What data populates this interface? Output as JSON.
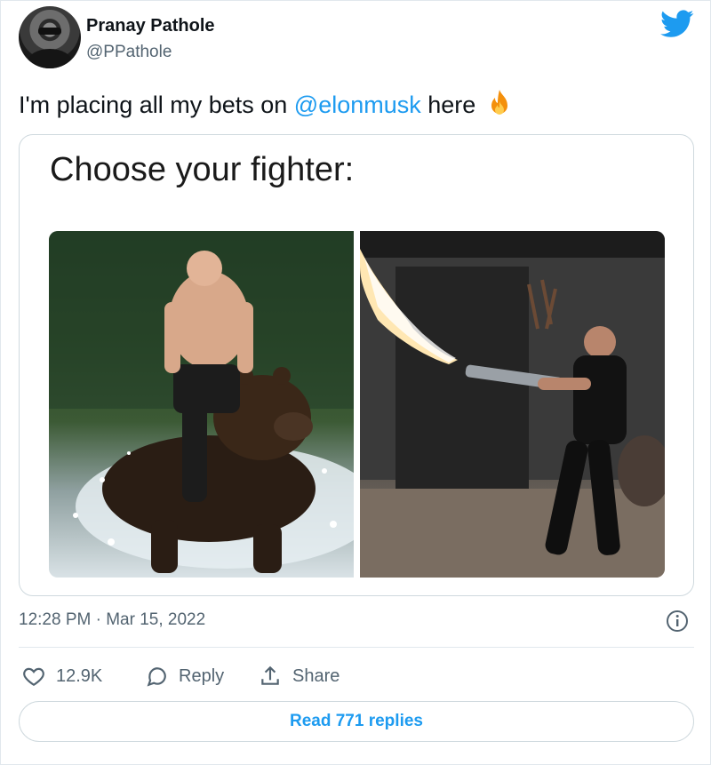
{
  "author": {
    "display_name": "Pranay Pathole",
    "handle": "@PPathole"
  },
  "tweet": {
    "text_before": "I'm placing all my bets on ",
    "mention": "@elonmusk",
    "text_after": " here",
    "emoji": "fire-icon"
  },
  "media": {
    "caption": "Choose your fighter:"
  },
  "meta": {
    "timestamp": "12:28 PM · Mar 15, 2022"
  },
  "actions": {
    "likes": "12.9K",
    "reply_label": "Reply",
    "share_label": "Share"
  },
  "footer": {
    "read_replies_label": "Read 771 replies"
  },
  "colors": {
    "accent": "#1d9bf0",
    "text_primary": "#0f1419",
    "text_secondary": "#536471",
    "border": "#cfd9de"
  }
}
